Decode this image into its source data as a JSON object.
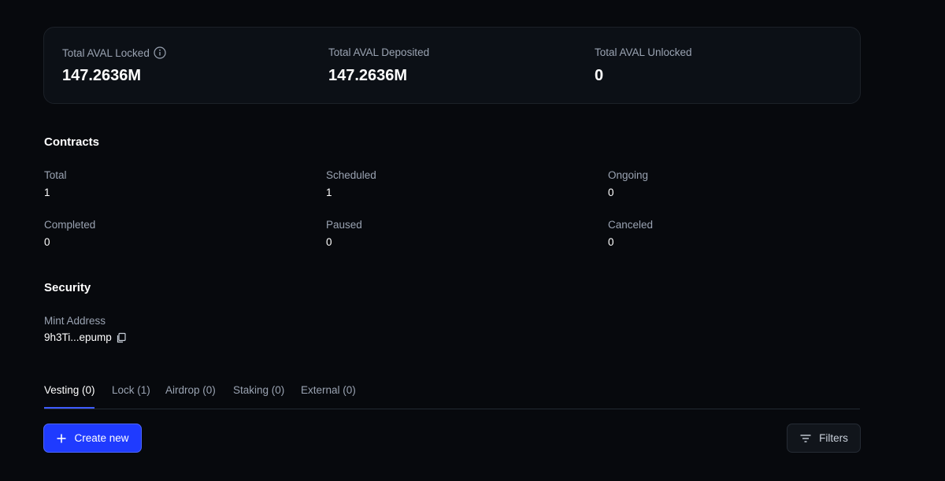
{
  "stats": [
    {
      "label": "Total AVAL Locked",
      "value": "147.2636M",
      "has_info": true
    },
    {
      "label": "Total AVAL Deposited",
      "value": "147.2636M",
      "has_info": false
    },
    {
      "label": "Total AVAL Unlocked",
      "value": "0",
      "has_info": false
    }
  ],
  "contracts": {
    "title": "Contracts",
    "items": [
      {
        "label": "Total",
        "value": "1"
      },
      {
        "label": "Scheduled",
        "value": "1"
      },
      {
        "label": "Ongoing",
        "value": "0"
      },
      {
        "label": "Completed",
        "value": "0"
      },
      {
        "label": "Paused",
        "value": "0"
      },
      {
        "label": "Canceled",
        "value": "0"
      }
    ]
  },
  "security": {
    "title": "Security",
    "mint_label": "Mint Address",
    "mint_value": "9h3Ti...epump"
  },
  "tabs": [
    {
      "label": "Vesting (0)",
      "active": true
    },
    {
      "label": "Lock (1)",
      "active": false
    },
    {
      "label": "Airdrop (0)",
      "active": false
    },
    {
      "label": "Staking (0)",
      "active": false
    },
    {
      "label": "External (0)",
      "active": false
    }
  ],
  "actions": {
    "create_label": "Create new",
    "filters_label": "Filters"
  },
  "colors": {
    "accent": "#1f3bff",
    "background": "#07090d",
    "muted_text": "#9aa3b2"
  }
}
